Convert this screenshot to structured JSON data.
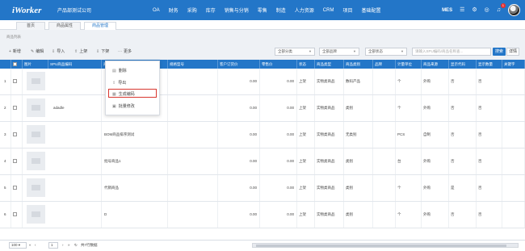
{
  "topbar": {
    "logo": "iWorker",
    "company": "产品部测试公司",
    "modules": [
      "OA",
      "财务",
      "采购",
      "库存",
      "销售与分销",
      "零售",
      "制造",
      "人力资源",
      "CRM",
      "项目",
      "基础配置"
    ],
    "mes": "MES",
    "notification_count": "1"
  },
  "tabs": [
    "首页",
    "商品属性",
    "商品管理"
  ],
  "breadcrumb": "商品列表",
  "toolbar": {
    "new": "新增",
    "edit": "编辑",
    "import": "导入",
    "up": "上架",
    "down": "下架",
    "more": "更多",
    "category_select": "全部分类",
    "brand_select": "全部品牌",
    "status_select": "全部状态",
    "search_placeholder": "请输入SPU编码/商品名称查...",
    "search_button": "搜索",
    "batch_button": "详情"
  },
  "more_menu": {
    "items": [
      "删除",
      "导出",
      "生成编码",
      "批量修改"
    ]
  },
  "columns": [
    "图片",
    "SPU商品编码",
    "商品名称",
    "规格型号",
    "客户订货价",
    "零售价",
    "状态",
    "商品类型",
    "商品类别",
    "品牌",
    "计量单位",
    "商品来源",
    "显示代码",
    "显示数量",
    "关键字"
  ],
  "rows": [
    {
      "no": "1",
      "spu": "",
      "name": "",
      "price": "0.00",
      "retail": "0.00",
      "status": "上架",
      "type": "实物类商品",
      "category": "数码产品",
      "brand": "",
      "unit": "个",
      "source": "外购",
      "show_code": "否",
      "show_qty": "否"
    },
    {
      "no": "2",
      "spu": "adadle",
      "name": "",
      "price": "0.00",
      "retail": "0.00",
      "status": "上架",
      "type": "实物类商品",
      "category": "类别",
      "brand": "",
      "unit": "个",
      "source": "外购",
      "show_code": "否",
      "show_qty": "否"
    },
    {
      "no": "3",
      "spu": "",
      "name": "BOM商品排序测试",
      "price": "0.00",
      "retail": "0.00",
      "status": "上架",
      "type": "实物类商品",
      "category": "无类别",
      "brand": "",
      "unit": "PCS",
      "source": "自制",
      "show_code": "否",
      "show_qty": "否"
    },
    {
      "no": "4",
      "spu": "",
      "name": "批号商品1",
      "price": "0.00",
      "retail": "0.00",
      "status": "上架",
      "type": "实物类商品",
      "category": "类别",
      "brand": "",
      "unit": "台",
      "source": "外购",
      "show_code": "否",
      "show_qty": "否"
    },
    {
      "no": "5",
      "spu": "",
      "name": "代销商品",
      "price": "0.00",
      "retail": "0.00",
      "status": "上架",
      "type": "实物类商品",
      "category": "类别",
      "brand": "",
      "unit": "个",
      "source": "外购",
      "show_code": "是",
      "show_qty": "否"
    },
    {
      "no": "6",
      "spu": "",
      "name": "D",
      "price": "0.00",
      "retail": "0.00",
      "status": "上架",
      "type": "实物类商品",
      "category": "类别",
      "brand": "",
      "unit": "个",
      "source": "外购",
      "show_code": "否",
      "show_qty": "否"
    }
  ],
  "footer": {
    "page_size": "100",
    "page": "1",
    "total": "共7行数据"
  },
  "colors": {
    "primary": "#2376c8",
    "highlight": "#d8372f"
  }
}
